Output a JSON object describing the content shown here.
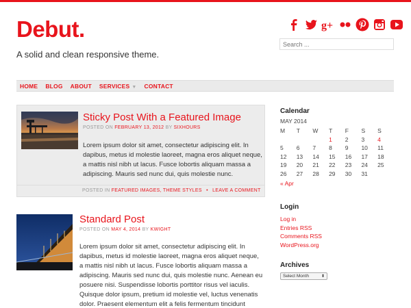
{
  "site": {
    "title": "Debut.",
    "tagline": "A solid and clean responsive theme."
  },
  "search": {
    "placeholder": "Search ..."
  },
  "social": [
    "facebook-icon",
    "twitter-icon",
    "google-plus-icon",
    "flickr-icon",
    "pinterest-icon",
    "instagram-icon",
    "youtube-icon"
  ],
  "colors": {
    "accent": "#e8141c",
    "nav_bg": "#eaeaea",
    "sticky_bg": "#ececec"
  },
  "nav": {
    "home": "HOME",
    "blog": "BLOG",
    "about": "ABOUT",
    "services": "SERVICES",
    "contact": "CONTACT"
  },
  "posts": [
    {
      "title": "Sticky Post With a Featured Image",
      "meta_prefix": "POSTED ON",
      "date": "FEBRUARY 13, 2012",
      "by": "BY",
      "author": "SIXHOURS",
      "excerpt": "Lorem ipsum dolor sit amet, consectetur adipiscing elit. In dapibus, metus id molestie laoreet, magna eros aliquet neque, a mattis nisl nibh ut lacus. Fusce lobortis aliquam massa a adipiscing. Mauris sed nunc dui, quis molestie nunc.",
      "posted_in": "POSTED IN",
      "categories": "FEATURED IMAGES, THEME STYLES",
      "comment": "LEAVE A COMMENT"
    },
    {
      "title": "Standard Post",
      "meta_prefix": "POSTED ON",
      "date": "MAY 4, 2014",
      "by": "BY",
      "author": "KWIGHT",
      "excerpt": "Lorem ipsum dolor sit amet, consectetur adipiscing elit. In dapibus, metus id molestie laoreet, magna eros aliquet neque, a mattis nisl nibh ut lacus. Fusce lobortis aliquam massa a adipiscing. Mauris sed nunc dui, quis molestie nunc. Aenean eu posuere nisi. Suspendisse lobortis porttitor risus vel iaculis. Quisque dolor ipsum, pretium id molestie vel, luctus venenatis dolor. Praesent elementum elit a felis fermentum tincidunt"
    }
  ],
  "calendar": {
    "title": "Calendar",
    "caption": "MAY 2014",
    "days": [
      "M",
      "T",
      "W",
      "T",
      "F",
      "S",
      "S"
    ],
    "weeks": [
      [
        "",
        "",
        "",
        "1",
        "2",
        "3",
        "4"
      ],
      [
        "5",
        "6",
        "7",
        "8",
        "9",
        "10",
        "11"
      ],
      [
        "12",
        "13",
        "14",
        "15",
        "16",
        "17",
        "18"
      ],
      [
        "19",
        "20",
        "21",
        "22",
        "23",
        "24",
        "25"
      ],
      [
        "26",
        "27",
        "28",
        "29",
        "30",
        "31",
        ""
      ]
    ],
    "linked_days": [
      "1",
      "4"
    ],
    "prev": "« Apr"
  },
  "login": {
    "title": "Login",
    "links": [
      "Log in",
      "Entries RSS",
      "Comments RSS",
      "WordPress.org"
    ]
  },
  "archives": {
    "title": "Archives",
    "select": "Select Month"
  }
}
